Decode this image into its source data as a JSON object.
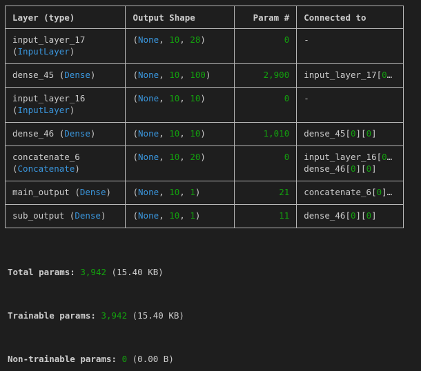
{
  "headers": {
    "layer": "Layer (type)",
    "output": "Output Shape",
    "params": "Param #",
    "connected": "Connected to"
  },
  "rows": [
    {
      "name": "input_layer_17",
      "type": "InputLayer",
      "inline_type": false,
      "shape": [
        "None",
        "10",
        "28"
      ],
      "params": "0",
      "connected": [
        {
          "kind": "dash",
          "text": "-"
        }
      ]
    },
    {
      "name": "dense_45",
      "type": "Dense",
      "inline_type": true,
      "shape": [
        "None",
        "10",
        "100"
      ],
      "params": "2,900",
      "connected": [
        {
          "kind": "ref",
          "text": "input_layer_17[",
          "idx": "0",
          "tail": "…"
        }
      ]
    },
    {
      "name": "input_layer_16",
      "type": "InputLayer",
      "inline_type": false,
      "shape": [
        "None",
        "10",
        "10"
      ],
      "params": "0",
      "connected": [
        {
          "kind": "dash",
          "text": "-"
        }
      ]
    },
    {
      "name": "dense_46",
      "type": "Dense",
      "inline_type": true,
      "shape": [
        "None",
        "10",
        "10"
      ],
      "params": "1,010",
      "connected": [
        {
          "kind": "full",
          "text": "dense_45[",
          "idx": "0",
          "mid": "][",
          "idx2": "0",
          "end": "]"
        }
      ]
    },
    {
      "name": "concatenate_6",
      "type": "Concatenate",
      "inline_type": false,
      "shape": [
        "None",
        "10",
        "20"
      ],
      "params": "0",
      "connected": [
        {
          "kind": "ref",
          "text": "input_layer_16[",
          "idx": "0",
          "tail": "…"
        },
        {
          "kind": "full",
          "text": "dense_46[",
          "idx": "0",
          "mid": "][",
          "idx2": "0",
          "end": "]"
        }
      ]
    },
    {
      "name": "main_output",
      "type": "Dense",
      "inline_type": true,
      "shape": [
        "None",
        "10",
        "1"
      ],
      "params": "21",
      "connected": [
        {
          "kind": "ref2",
          "text": "concatenate_6[",
          "idx": "0",
          "tail": "]…"
        }
      ]
    },
    {
      "name": "sub_output",
      "type": "Dense",
      "inline_type": true,
      "shape": [
        "None",
        "10",
        "1"
      ],
      "params": "11",
      "connected": [
        {
          "kind": "full",
          "text": "dense_46[",
          "idx": "0",
          "mid": "][",
          "idx2": "0",
          "end": "]"
        }
      ]
    }
  ],
  "totals": {
    "total_label": "Total params:",
    "total_value": "3,942",
    "total_size": "(15.40 KB)",
    "trainable_label": "Trainable params:",
    "trainable_value": "3,942",
    "trainable_size": "(15.40 KB)",
    "nontrainable_label": "Non-trainable params:",
    "nontrainable_value": "0",
    "nontrainable_size": "(0.00 B)"
  },
  "colors": {
    "background": "#1e1e1e",
    "text": "#cccccc",
    "type_blue": "#3a96dd",
    "number_green": "#13a10e",
    "none_cyan": "#3a96dd",
    "border": "#b8b8b8"
  }
}
